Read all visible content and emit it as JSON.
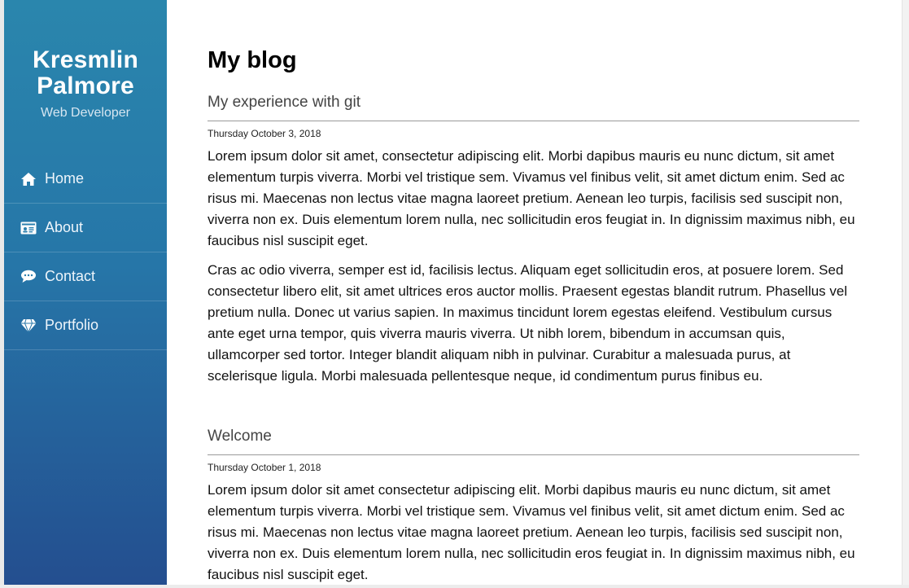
{
  "sidebar": {
    "brand_line1": "Kresmlin",
    "brand_line2": "Palmore",
    "role": "Web Developer",
    "nav": [
      {
        "label": "Home",
        "icon": "home-icon"
      },
      {
        "label": "About",
        "icon": "id-card-icon"
      },
      {
        "label": "Contact",
        "icon": "chat-bubble-icon"
      },
      {
        "label": "Portfolio",
        "icon": "diamond-icon"
      }
    ],
    "colors": {
      "top": "#2a86ad",
      "bottom": "#244e8f"
    }
  },
  "main": {
    "title": "My blog",
    "posts": [
      {
        "title": "My experience with git",
        "date": "Thursday October 3, 2018",
        "paragraphs": [
          "Lorem ipsum dolor sit amet, consectetur adipiscing elit. Morbi dapibus mauris eu nunc dictum, sit amet elementum turpis viverra. Morbi vel tristique sem. Vivamus vel finibus velit, sit amet dictum enim. Sed ac risus mi. Maecenas non lectus vitae magna laoreet pretium. Aenean leo turpis, facilisis sed suscipit non, viverra non ex. Duis elementum lorem nulla, nec sollicitudin eros feugiat in. In dignissim maximus nibh, eu faucibus nisl suscipit eget.",
          "Cras ac odio viverra, semper est id, facilisis lectus. Aliquam eget sollicitudin eros, at posuere lorem. Sed consectetur libero elit, sit amet ultrices eros auctor mollis. Praesent egestas blandit rutrum. Phasellus vel pretium nulla. Donec ut varius sapien. In maximus tincidunt lorem egestas eleifend. Vestibulum cursus ante eget urna tempor, quis viverra mauris viverra. Ut nibh lorem, bibendum in accumsan quis, ullamcorper sed tortor. Integer blandit aliquam nibh in pulvinar. Curabitur a malesuada purus, at scelerisque ligula. Morbi malesuada pellentesque neque, id condimentum purus finibus eu."
        ]
      },
      {
        "title": "Welcome",
        "date": "Thursday October 1, 2018",
        "paragraphs": [
          "Lorem ipsum dolor sit amet consectetur adipiscing elit. Morbi dapibus mauris eu nunc dictum, sit amet elementum turpis viverra. Morbi vel tristique sem. Vivamus vel finibus velit, sit amet dictum enim. Sed ac risus mi. Maecenas non lectus vitae magna laoreet pretium. Aenean leo turpis, facilisis sed suscipit non, viverra non ex. Duis elementum lorem nulla, nec sollicitudin eros feugiat in. In dignissim maximus nibh, eu faucibus nisl suscipit eget."
        ]
      }
    ]
  }
}
